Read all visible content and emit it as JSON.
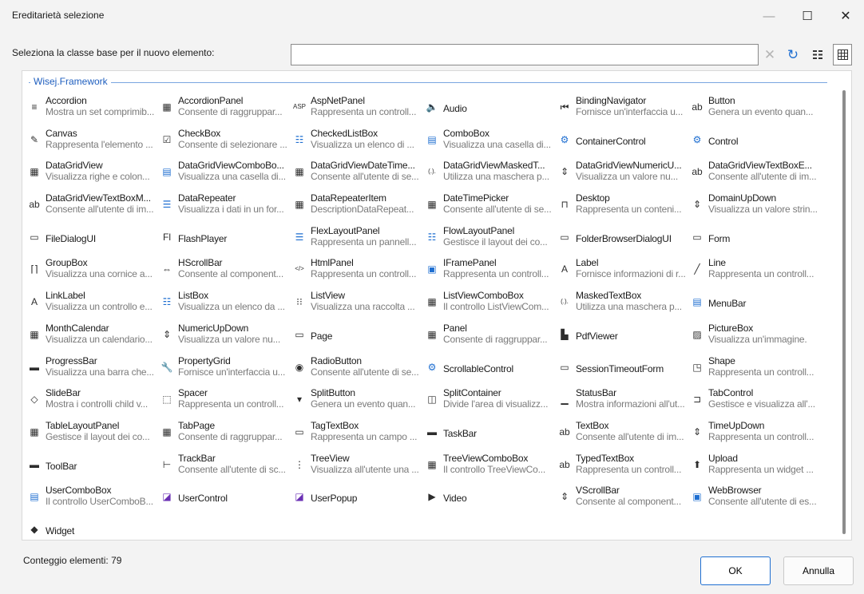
{
  "window": {
    "title": "Ereditarietà selezione",
    "minimize_icon": "minimize-icon",
    "maximize_icon": "maximize-icon",
    "close_icon": "close-icon"
  },
  "prompt": {
    "label": "Seleziona la classe base per il nuovo elemento:",
    "search_value": "",
    "search_placeholder": ""
  },
  "group": {
    "title": "Wisej.Framework"
  },
  "items": [
    {
      "name": "Accordion",
      "desc": "Mostra un set comprimib...",
      "icon": "≡"
    },
    {
      "name": "AccordionPanel",
      "desc": "Consente di raggruppar...",
      "icon": "▦"
    },
    {
      "name": "AspNetPanel",
      "desc": "Rappresenta un controll...",
      "icon": "ASP"
    },
    {
      "name": "Audio",
      "desc": "",
      "icon": "🔈"
    },
    {
      "name": "BindingNavigator",
      "desc": "Fornisce un'interfaccia u...",
      "icon": "⏮"
    },
    {
      "name": "Button",
      "desc": "Genera un evento quan...",
      "icon": "ab"
    },
    {
      "name": "Canvas",
      "desc": "Rappresenta l'elemento ...",
      "icon": "✎"
    },
    {
      "name": "CheckBox",
      "desc": "Consente di selezionare ...",
      "icon": "☑"
    },
    {
      "name": "CheckedListBox",
      "desc": "Visualizza un elenco di ...",
      "icon": "☷"
    },
    {
      "name": "ComboBox",
      "desc": "Visualizza una casella di...",
      "icon": "▤"
    },
    {
      "name": "ContainerControl",
      "desc": "",
      "icon": "⚙"
    },
    {
      "name": "Control",
      "desc": "",
      "icon": "⚙"
    },
    {
      "name": "DataGridView",
      "desc": "Visualizza righe e colon...",
      "icon": "▦"
    },
    {
      "name": "DataGridViewComboBo...",
      "desc": "Visualizza una casella di...",
      "icon": "▤"
    },
    {
      "name": "DataGridViewDateTime...",
      "desc": "Consente all'utente di se...",
      "icon": "▦"
    },
    {
      "name": "DataGridViewMaskedT...",
      "desc": "Utilizza una maschera p...",
      "icon": "(.)."
    },
    {
      "name": "DataGridViewNumericU...",
      "desc": "Visualizza un valore nu...",
      "icon": "⇕"
    },
    {
      "name": "DataGridViewTextBoxE...",
      "desc": "Consente all'utente di im...",
      "icon": "ab"
    },
    {
      "name": "DataGridViewTextBoxM...",
      "desc": "Consente all'utente di im...",
      "icon": "ab"
    },
    {
      "name": "DataRepeater",
      "desc": "Visualizza i dati in un for...",
      "icon": "☰"
    },
    {
      "name": "DataRepeaterItem",
      "desc": "DescriptionDataRepeat...",
      "icon": "▦"
    },
    {
      "name": "DateTimePicker",
      "desc": "Consente all'utente di se...",
      "icon": "▦"
    },
    {
      "name": "Desktop",
      "desc": "Rappresenta un conteni...",
      "icon": "⊓"
    },
    {
      "name": "DomainUpDown",
      "desc": "Visualizza un valore strin...",
      "icon": "⇕"
    },
    {
      "name": "FileDialogUI",
      "desc": "",
      "icon": "▭"
    },
    {
      "name": "FlashPlayer",
      "desc": "",
      "icon": "Fl"
    },
    {
      "name": "FlexLayoutPanel",
      "desc": "Rappresenta un pannell...",
      "icon": "☰"
    },
    {
      "name": "FlowLayoutPanel",
      "desc": "Gestisce il layout dei co...",
      "icon": "☷"
    },
    {
      "name": "FolderBrowserDialogUI",
      "desc": "",
      "icon": "▭"
    },
    {
      "name": "Form",
      "desc": "",
      "icon": "▭"
    },
    {
      "name": "GroupBox",
      "desc": "Visualizza una cornice a...",
      "icon": "⌈⌉"
    },
    {
      "name": "HScrollBar",
      "desc": "Consente al component...",
      "icon": "⇔"
    },
    {
      "name": "HtmlPanel",
      "desc": "Rappresenta un controll...",
      "icon": "</>"
    },
    {
      "name": "IFramePanel",
      "desc": "Rappresenta un controll...",
      "icon": "▣"
    },
    {
      "name": "Label",
      "desc": "Fornisce informazioni di r...",
      "icon": "A"
    },
    {
      "name": "Line",
      "desc": "Rappresenta un controll...",
      "icon": "╱"
    },
    {
      "name": "LinkLabel",
      "desc": "Visualizza un controllo e...",
      "icon": "A"
    },
    {
      "name": "ListBox",
      "desc": "Visualizza un elenco da ...",
      "icon": "☷"
    },
    {
      "name": "ListView",
      "desc": "Visualizza una raccolta ...",
      "icon": "⁝⁝"
    },
    {
      "name": "ListViewComboBox",
      "desc": "Il controllo ListViewCom...",
      "icon": "▦"
    },
    {
      "name": "MaskedTextBox",
      "desc": "Utilizza una maschera p...",
      "icon": "(.)."
    },
    {
      "name": "MenuBar",
      "desc": "",
      "icon": "▤"
    },
    {
      "name": "MonthCalendar",
      "desc": "Visualizza un calendario...",
      "icon": "▦"
    },
    {
      "name": "NumericUpDown",
      "desc": "Visualizza un valore nu...",
      "icon": "⇕"
    },
    {
      "name": "Page",
      "desc": "",
      "icon": "▭"
    },
    {
      "name": "Panel",
      "desc": "Consente di raggruppar...",
      "icon": "▦"
    },
    {
      "name": "PdfViewer",
      "desc": "",
      "icon": "▙"
    },
    {
      "name": "PictureBox",
      "desc": "Visualizza un'immagine.",
      "icon": "▨"
    },
    {
      "name": "ProgressBar",
      "desc": "Visualizza una barra che...",
      "icon": "▬"
    },
    {
      "name": "PropertyGrid",
      "desc": "Fornisce un'interfaccia u...",
      "icon": "🔧"
    },
    {
      "name": "RadioButton",
      "desc": "Consente all'utente di se...",
      "icon": "◉"
    },
    {
      "name": "ScrollableControl",
      "desc": "",
      "icon": "⚙"
    },
    {
      "name": "SessionTimeoutForm",
      "desc": "",
      "icon": "▭"
    },
    {
      "name": "Shape",
      "desc": "Rappresenta un controll...",
      "icon": "◳"
    },
    {
      "name": "SlideBar",
      "desc": "Mostra i controlli child v...",
      "icon": "◇"
    },
    {
      "name": "Spacer",
      "desc": "Rappresenta un controll...",
      "icon": "⬚"
    },
    {
      "name": "SplitButton",
      "desc": "Genera un evento quan...",
      "icon": "▾"
    },
    {
      "name": "SplitContainer",
      "desc": "Divide l'area di visualizz...",
      "icon": "◫"
    },
    {
      "name": "StatusBar",
      "desc": "Mostra informazioni all'ut...",
      "icon": "▁"
    },
    {
      "name": "TabControl",
      "desc": "Gestisce e visualizza all'...",
      "icon": "⊐"
    },
    {
      "name": "TableLayoutPanel",
      "desc": "Gestisce il layout dei co...",
      "icon": "▦"
    },
    {
      "name": "TabPage",
      "desc": "Consente di raggruppar...",
      "icon": "▦"
    },
    {
      "name": "TagTextBox",
      "desc": "Rappresenta un campo ...",
      "icon": "▭"
    },
    {
      "name": "TaskBar",
      "desc": "",
      "icon": "▬"
    },
    {
      "name": "TextBox",
      "desc": "Consente all'utente di im...",
      "icon": "ab"
    },
    {
      "name": "TimeUpDown",
      "desc": "Rappresenta un controll...",
      "icon": "⇕"
    },
    {
      "name": "ToolBar",
      "desc": "",
      "icon": "▬"
    },
    {
      "name": "TrackBar",
      "desc": "Consente all'utente di sc...",
      "icon": "⊢"
    },
    {
      "name": "TreeView",
      "desc": "Visualizza all'utente una ...",
      "icon": "⋮"
    },
    {
      "name": "TreeViewComboBox",
      "desc": "Il controllo TreeViewCo...",
      "icon": "▦"
    },
    {
      "name": "TypedTextBox",
      "desc": "Rappresenta un controll...",
      "icon": "ab"
    },
    {
      "name": "Upload",
      "desc": "Rappresenta un widget ...",
      "icon": "⬆"
    },
    {
      "name": "UserComboBox",
      "desc": "Il controllo UserComboB...",
      "icon": "▤"
    },
    {
      "name": "UserControl",
      "desc": "",
      "icon": "◪"
    },
    {
      "name": "UserPopup",
      "desc": "",
      "icon": "◪"
    },
    {
      "name": "Video",
      "desc": "",
      "icon": "▶"
    },
    {
      "name": "VScrollBar",
      "desc": "Consente al component...",
      "icon": "⇕"
    },
    {
      "name": "WebBrowser",
      "desc": "Consente all'utente di es...",
      "icon": "▣"
    },
    {
      "name": "Widget",
      "desc": "",
      "icon": "◆"
    }
  ],
  "status": {
    "count_label": "Conteggio elementi: 79"
  },
  "buttons": {
    "ok_label": "OK",
    "cancel_label": "Annulla"
  },
  "colors": {
    "accent": "#1f6fd1",
    "group_title": "#1f5fbf"
  }
}
